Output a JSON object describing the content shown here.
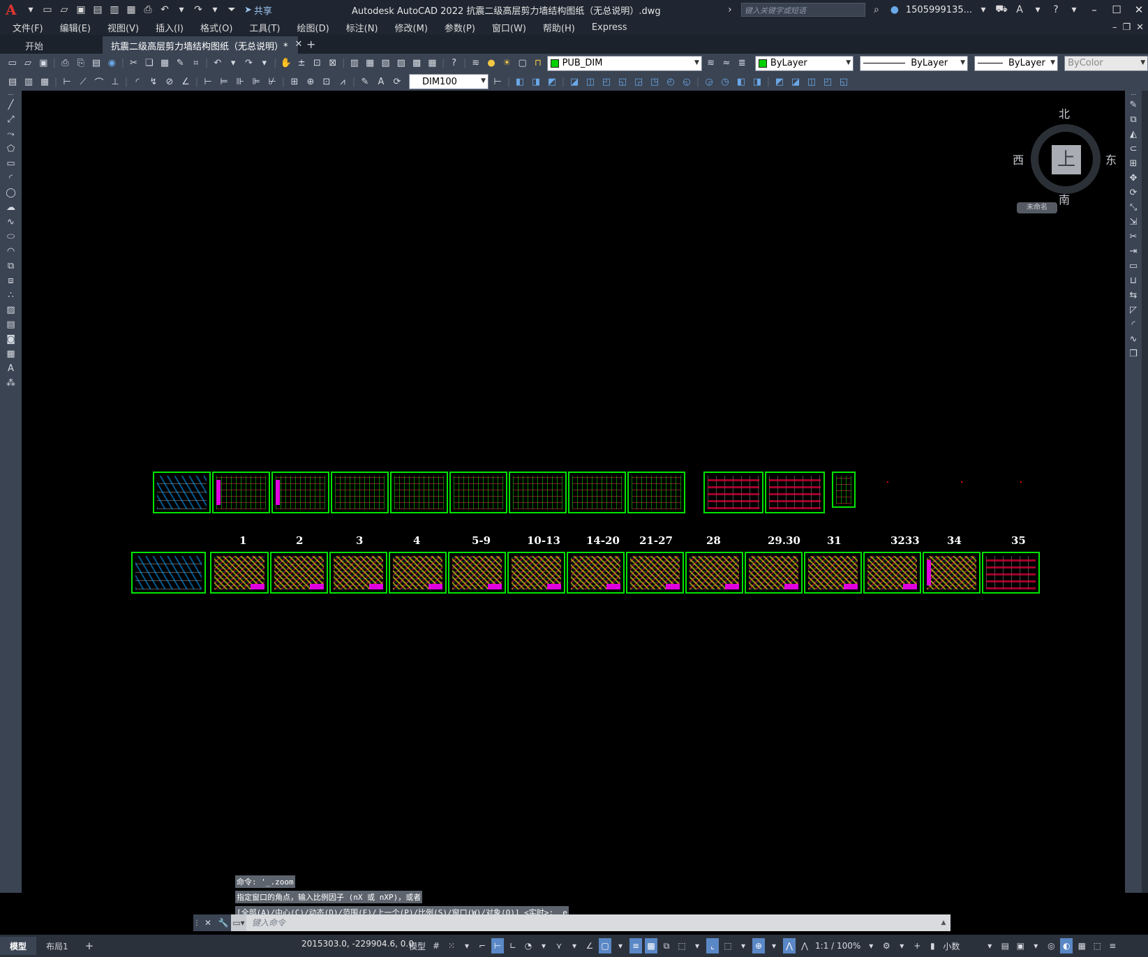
{
  "app": {
    "title": "Autodesk AutoCAD 2022    抗震二级高层剪力墙结构图纸（无总说明）.dwg",
    "logo": "A",
    "share_label": "共享",
    "search_placeholder": "键入关键字或短语",
    "user": "1505999135..."
  },
  "menu": [
    "文件(F)",
    "编辑(E)",
    "视图(V)",
    "插入(I)",
    "格式(O)",
    "工具(T)",
    "绘图(D)",
    "标注(N)",
    "修改(M)",
    "参数(P)",
    "窗口(W)",
    "帮助(H)",
    "Express"
  ],
  "tabs": {
    "start": "开始",
    "active": "抗震二级高层剪力墙结构图纸（无总说明）*",
    "close": "✕",
    "add": "+"
  },
  "toolbar": {
    "layer": "PUB_DIM",
    "color": "ByLayer",
    "linetype": "ByLayer",
    "lineweight": "ByLayer",
    "plotstyle": "ByColor",
    "dimstyle": "DIM100",
    "colors": {
      "layer_swatch": "#00d000",
      "accent": "#5a87c5"
    }
  },
  "viewcube": {
    "north": "北",
    "south": "南",
    "west": "西",
    "east": "东",
    "face": "上",
    "wcs": "未命名"
  },
  "drawing": {
    "sheet_numbers": [
      "1",
      "2",
      "3",
      "4",
      "5-9",
      "10-13",
      "14-20",
      "21-27",
      "28",
      "29.30",
      "31",
      "3233",
      "34",
      "35"
    ]
  },
  "command": {
    "history": [
      "命令: '_.zoom",
      "指定窗口的角点，输入比例因子 (nX 或 nXP)，或者",
      "[全部(A)/中心(C)/动态(D)/范围(E)/上一个(P)/比例(S)/窗口(W)/对象(O)] <实时>: _e"
    ],
    "placeholder": "键入命令"
  },
  "status": {
    "layout_tabs": [
      "模型",
      "布局1"
    ],
    "layout_add": "+",
    "coords": "2015303.0, -229904.6, 0.0",
    "model_label": "模型",
    "scale": "1:1 / 100%",
    "units": "小数"
  }
}
